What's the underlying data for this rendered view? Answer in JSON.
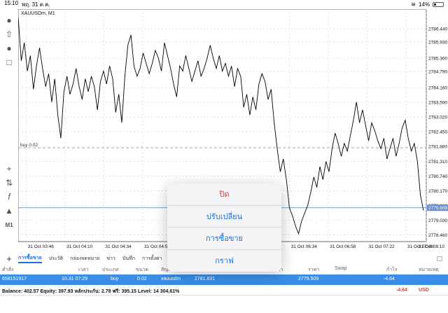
{
  "status": {
    "time": "15:10",
    "date": "พฤ. 31 ต.ค.",
    "battery": "14%"
  },
  "chart": {
    "symbol": "XAUUSDm, M1",
    "buy_label": "buy 0.02",
    "price_badge": "2779.509",
    "colors": {
      "line": "#000000",
      "grid": "#cfcfcf",
      "buy_line": "#9aa0a6",
      "bid_line": "#6a8fc9",
      "badge": "#6a8fc9"
    }
  },
  "chart_data": {
    "type": "line",
    "title": "",
    "series": [
      {
        "values": [
          2786.9,
          2785.2,
          2785.9,
          2784.8,
          2785.4,
          2784.1,
          2785.0,
          2785.7,
          2784.9,
          2784.2,
          2784.7,
          2783.6,
          2784.5,
          2783.1,
          2782.2,
          2784.0,
          2784.6,
          2783.9,
          2784.3,
          2784.9,
          2784.2,
          2783.7,
          2784.5,
          2784.0,
          2784.6,
          2784.2,
          2783.3,
          2784.4,
          2784.8,
          2784.3,
          2785.0,
          2784.5,
          2783.2,
          2783.9,
          2782.8,
          2784.6,
          2785.8,
          2786.2,
          2785.0,
          2784.6,
          2784.9,
          2785.5,
          2785.1,
          2784.7,
          2785.1,
          2785.6,
          2785.3,
          2784.8,
          2785.9,
          2785.4,
          2784.9,
          2784.3,
          2783.8,
          2785.0,
          2784.8,
          2785.4,
          2784.9,
          2784.4,
          2784.8,
          2785.2,
          2784.6,
          2784.9,
          2785.3,
          2785.8,
          2785.3,
          2784.9,
          2785.4,
          2784.8,
          2785.1,
          2784.6,
          2785.0,
          2784.2,
          2784.9,
          2784.6,
          2783.4,
          2783.9,
          2783.1,
          2783.8,
          2783.3,
          2784.3,
          2784.7,
          2784.4,
          2783.7,
          2784.1,
          2782.8,
          2781.8,
          2780.9,
          2781.4,
          2780.6,
          2779.5,
          2779.2,
          2778.8,
          2778.5,
          2779.0,
          2779.3,
          2779.6,
          2780.1,
          2780.7,
          2780.3,
          2781.1,
          2780.6,
          2781.3,
          2780.9,
          2781.8,
          2782.4,
          2782.0,
          2781.5,
          2782.0,
          2781.7,
          2782.3,
          2782.9,
          2783.6,
          2782.8,
          2783.3,
          2782.7,
          2782.1,
          2782.8,
          2782.5,
          2782.1,
          2781.8,
          2782.2,
          2781.4,
          2781.8,
          2782.2,
          2781.5,
          2782.0,
          2782.6,
          2782.9,
          2782.2,
          2781.7,
          2782.0,
          2781.3,
          2780.0,
          2779.4
        ]
      }
    ],
    "x_tick_labels": [
      "31 Oct 03:46",
      "31 Oct 04:10",
      "31 Oct 04:34",
      "31 Oct 04:58",
      "31 Oct 06:34",
      "31 Oct 06:58",
      "31 Oct 07:22",
      "31 Oct 07:46",
      "31 Oct 08:10"
    ],
    "y_tick_labels": [
      "2786.440",
      "2785.930",
      "2785.300",
      "2784.790",
      "2784.160",
      "2783.590",
      "2783.020",
      "2782.450",
      "2781.880",
      "2781.310",
      "2780.740",
      "2780.170",
      "2779.600",
      "2779.030",
      "2778.460"
    ],
    "ylim": [
      2778.2,
      2787.2
    ],
    "buy_price": 2781.831,
    "bid_price": 2779.509,
    "grid": true
  },
  "left_tools": [
    "profile-icon",
    "upload-icon",
    "chat-icon",
    "add-document-icon",
    "crosshair-icon",
    "indicators-icon",
    "function-icon",
    "objects-icon",
    "timeframe-icon"
  ],
  "timeframe_label": "M1",
  "tabs": [
    {
      "label": "การซื้อขาย",
      "active": true
    },
    {
      "label": "ประวัติ"
    },
    {
      "label": "กล่องจดหมาย"
    },
    {
      "label": "ข่าว"
    },
    {
      "label": "บันทึก"
    },
    {
      "label": "การตั้งค่า"
    }
  ],
  "table": {
    "headers": [
      "คำสั่ง",
      "เวลา",
      "ประเภท",
      "ขนาด",
      "สัญลักษณ์",
      "ราคา",
      "ราคา",
      "Swap",
      "กำไร",
      "หมายเหตุ"
    ],
    "row": {
      "order": "658151917",
      "time": "10.31 07:29",
      "type": "buy",
      "size": "0.02",
      "symbol": "xauusdm",
      "open_price": "2781.831",
      "current_price": "2779.509",
      "profit": "-4.64"
    }
  },
  "balance": {
    "text": "Balance: 402.57 Equity: 397.93 หลักประกัน: 2.78 ฟรี: 395.15 Level: 14 304.61%",
    "profit": "-4.64",
    "currency": "USD"
  },
  "menu": {
    "close": "ปิด",
    "modify": "ปรับเปลี่ยน",
    "trade": "การซื้อขาย",
    "chart": "กราฟ"
  }
}
